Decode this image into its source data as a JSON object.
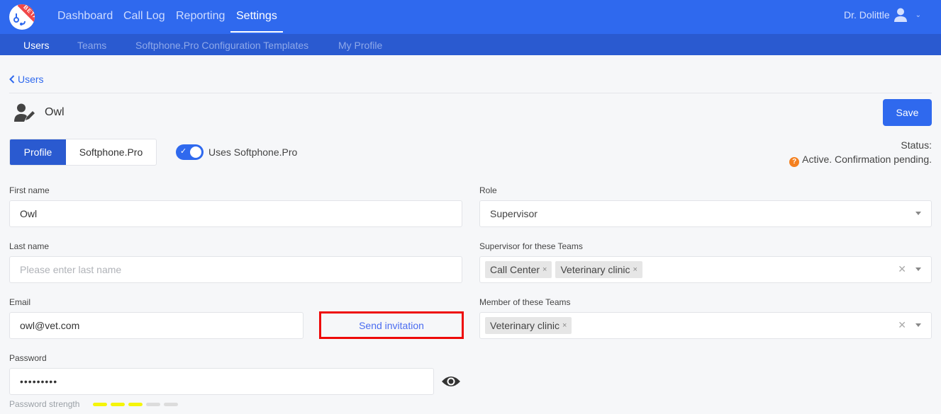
{
  "app": {
    "logo_badge": "BETA",
    "nav": [
      {
        "label": "Dashboard",
        "active": false
      },
      {
        "label": "Call Log",
        "active": false
      },
      {
        "label": "Reporting",
        "active": false
      },
      {
        "label": "Settings",
        "active": true
      }
    ],
    "user_name": "Dr. Dolittle"
  },
  "subnav": [
    {
      "label": "Users",
      "active": true
    },
    {
      "label": "Teams",
      "active": false
    },
    {
      "label": "Softphone.Pro Configuration Templates",
      "active": false
    },
    {
      "label": "My Profile",
      "active": false
    }
  ],
  "breadcrumb": {
    "back_label": "Users"
  },
  "user": {
    "name": "Owl"
  },
  "toolbar": {
    "save_label": "Save"
  },
  "status": {
    "label": "Status:",
    "value": "Active. Confirmation pending.",
    "icon": "question-circle-icon",
    "icon_color": "#f4801f"
  },
  "tabs": [
    {
      "label": "Profile",
      "active": true
    },
    {
      "label": "Softphone.Pro",
      "active": false
    }
  ],
  "toggle": {
    "label": "Uses Softphone.Pro",
    "checked": true
  },
  "form": {
    "first_name": {
      "label": "First name",
      "value": "Owl",
      "placeholder": ""
    },
    "last_name": {
      "label": "Last name",
      "value": "",
      "placeholder": "Please enter last name"
    },
    "email": {
      "label": "Email",
      "value": "owl@vet.com"
    },
    "send_invitation_label": "Send invitation",
    "password": {
      "label": "Password",
      "value": "•••••••••",
      "strength_label": "Password strength",
      "strength_level": 3,
      "strength_max": 5
    },
    "role": {
      "label": "Role",
      "value": "Supervisor"
    },
    "supervisor_teams": {
      "label": "Supervisor for these Teams",
      "chips": [
        "Call Center",
        "Veterinary clinic"
      ]
    },
    "member_teams": {
      "label": "Member of these Teams",
      "chips": [
        "Veterinary clinic"
      ]
    }
  },
  "colors": {
    "primary": "#2f69ee",
    "subnav": "#2a5ad0",
    "highlight_border": "#ee0a0a",
    "strength_on": "#f5f50a"
  }
}
